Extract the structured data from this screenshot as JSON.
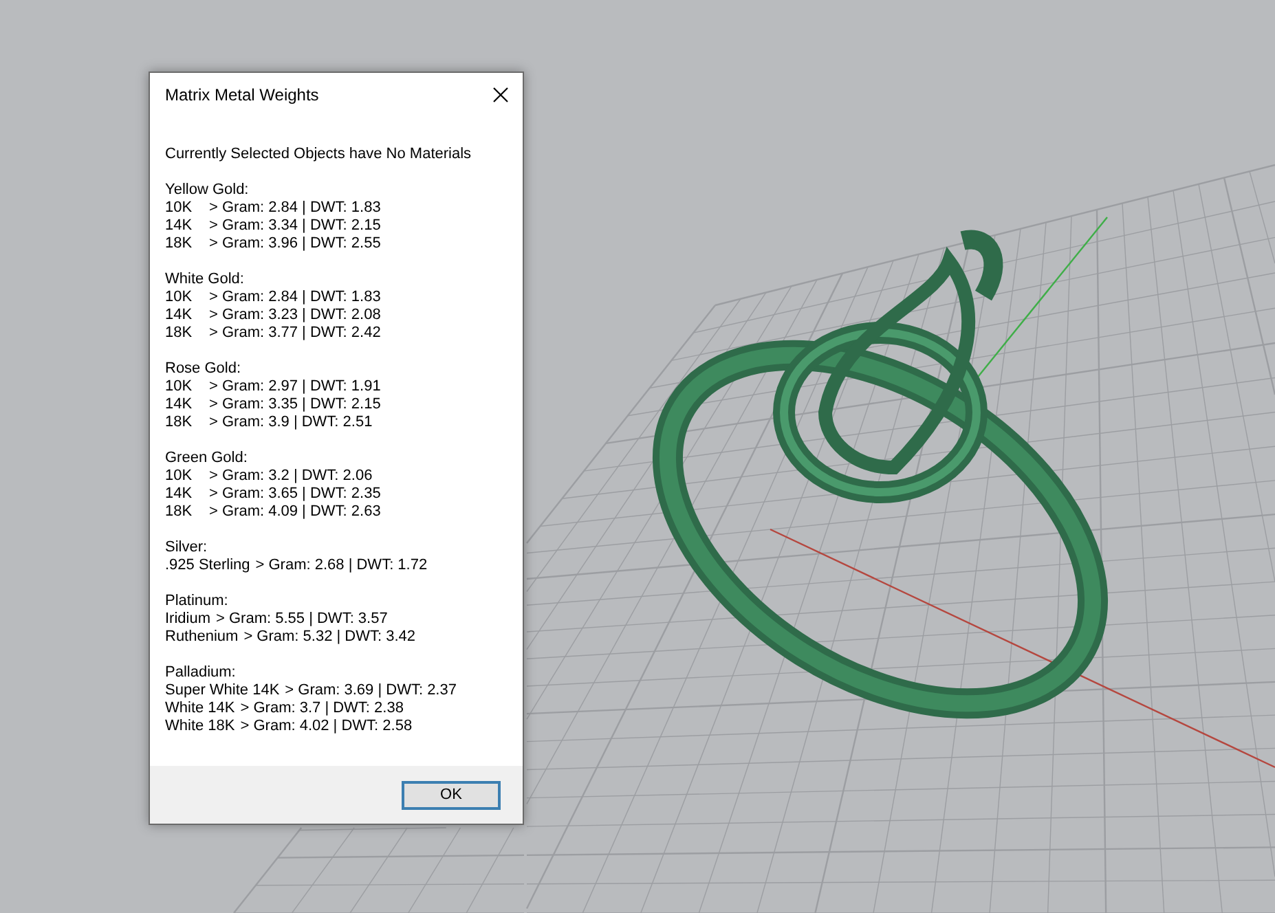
{
  "dialog": {
    "title": "Matrix Metal Weights",
    "message": "Currently Selected Objects have No Materials",
    "groups": [
      {
        "name": "Yellow Gold:",
        "kind": "columns",
        "lines": [
          {
            "grade": "10K",
            "value": "> Gram: 2.84 | DWT: 1.83"
          },
          {
            "grade": "14K",
            "value": "> Gram: 3.34 | DWT: 2.15"
          },
          {
            "grade": "18K",
            "value": "> Gram: 3.96 | DWT: 2.55"
          }
        ]
      },
      {
        "name": "White Gold:",
        "kind": "columns",
        "lines": [
          {
            "grade": "10K",
            "value": "> Gram: 2.84 | DWT: 1.83"
          },
          {
            "grade": "14K",
            "value": "> Gram: 3.23 | DWT: 2.08"
          },
          {
            "grade": "18K",
            "value": "> Gram: 3.77 | DWT: 2.42"
          }
        ]
      },
      {
        "name": "Rose Gold:",
        "kind": "columns",
        "lines": [
          {
            "grade": "10K",
            "value": "> Gram: 2.97 | DWT: 1.91"
          },
          {
            "grade": "14K",
            "value": "> Gram: 3.35 | DWT: 2.15"
          },
          {
            "grade": "18K",
            "value": "> Gram: 3.9 | DWT: 2.51"
          }
        ]
      },
      {
        "name": "Green Gold:",
        "kind": "columns",
        "lines": [
          {
            "grade": "10K",
            "value": "> Gram: 3.2 | DWT: 2.06"
          },
          {
            "grade": "14K",
            "value": "> Gram: 3.65 | DWT: 2.35"
          },
          {
            "grade": "18K",
            "value": "> Gram: 4.09 | DWT: 2.63"
          }
        ]
      },
      {
        "name": "Silver:",
        "kind": "inline",
        "lines": [
          {
            "grade": ".925 Sterling",
            "value": "> Gram: 2.68 | DWT: 1.72"
          }
        ]
      },
      {
        "name": "Platinum:",
        "kind": "inline",
        "lines": [
          {
            "grade": "Iridium",
            "value": "> Gram: 5.55 | DWT: 3.57"
          },
          {
            "grade": "Ruthenium",
            "value": "> Gram: 5.32 | DWT: 3.42"
          }
        ]
      },
      {
        "name": "Palladium:",
        "kind": "inline",
        "lines": [
          {
            "grade": "Super White 14K",
            "value": "> Gram: 3.69 | DWT: 2.37"
          },
          {
            "grade": "White 14K",
            "value": "> Gram: 3.7 | DWT: 2.38"
          },
          {
            "grade": "White 18K",
            "value": "> Gram: 4.02 | DWT: 2.58"
          }
        ]
      }
    ],
    "ok_button": "OK"
  }
}
